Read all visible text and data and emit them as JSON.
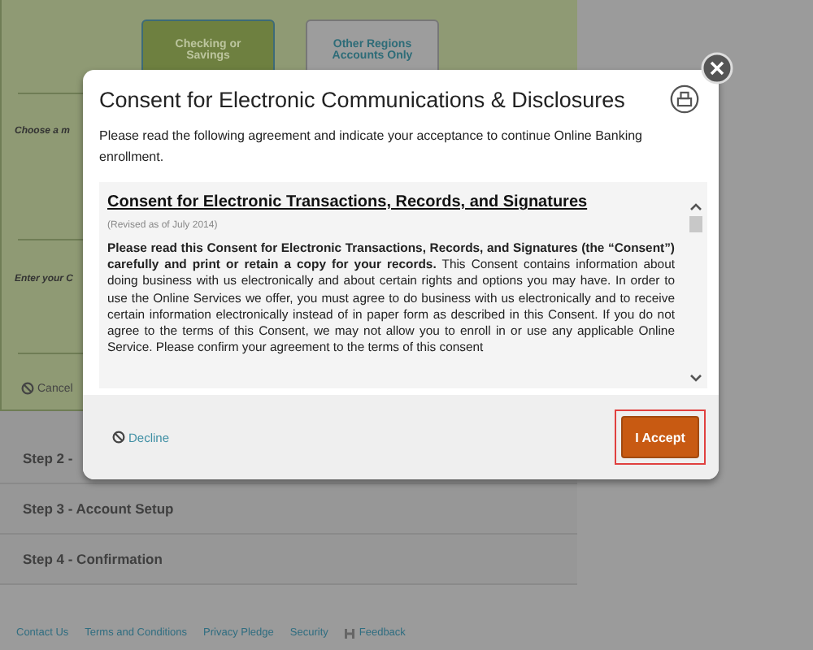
{
  "account_tabs": [
    {
      "label": "Checking or Savings",
      "selected": true
    },
    {
      "label": "Other Regions Accounts Only",
      "selected": false
    }
  ],
  "form_labels": [
    "Choose a m",
    "Enter your C"
  ],
  "cancel": "Cancel",
  "steps": [
    "Step 2 -",
    "Step 3 - Account Setup",
    "Step 4 - Confirmation"
  ],
  "footer_links": [
    "Contact Us",
    "Terms and Conditions",
    "Privacy Pledge",
    "Security"
  ],
  "feedback_link": "Feedback",
  "dialog": {
    "title": "Consent for Electronic Communications & Disclosures",
    "intro": "Please read the following agreement and indicate your acceptance to continue Online Banking enrollment.",
    "document": {
      "heading": "Consent for Electronic Transactions, Records, and Signatures",
      "revised": "(Revised as of July 2014)",
      "body": "**Please read this Consent for Electronic Transactions, Records, and Signatures (the “Consent”) carefully and print or retain a copy for your records.** This Consent contains information about doing business with us electronically and about certain rights and options you may have.  In order to use the Online Services we offer, you must agree to do business with us electronically and to receive certain information electronically instead of in paper form as described in this Consent.  If you do not agree to the terms of this Consent, we may not allow you to enroll in or use any applicable Online Service.  Please confirm your agreement to the terms of this consent"
    },
    "decline": "Decline",
    "accept": "I Accept"
  }
}
